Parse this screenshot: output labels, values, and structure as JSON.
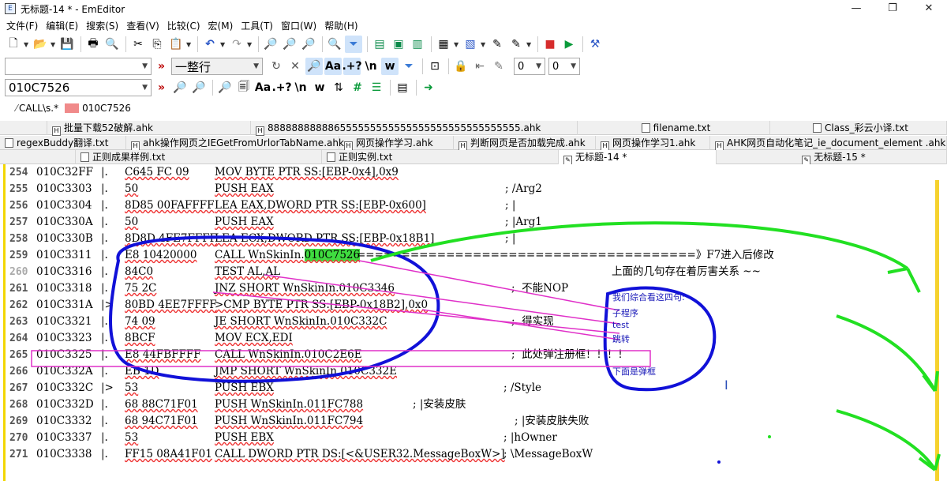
{
  "window": {
    "title": "无标题-14 * - EmEditor",
    "app_icon": "app-icon",
    "controls": [
      "—",
      "❐",
      "✕"
    ]
  },
  "menu": [
    "文件(F)",
    "编辑(E)",
    "搜索(S)",
    "查看(V)",
    "比较(C)",
    "宏(M)",
    "工具(T)",
    "窗口(W)",
    "帮助(H)"
  ],
  "toolbar2": {
    "combo1_value": "",
    "combo2_value": "一整行",
    "num1": "0",
    "num2": "0"
  },
  "toolbar3": {
    "search_value": "010C7526"
  },
  "searchbar": {
    "pattern": "CALL\\s.*",
    "highlight_text": "010C7526"
  },
  "tabs_row1": [
    "批量下载52破解.ahk",
    "888888888886555555555555555555555555555555.ahk",
    "filename.txt",
    "Class_彩云小译.txt"
  ],
  "tabs_row2": [
    "regexBuddy翻译.txt",
    "ahk操作网页之IEGetFromUrlorTabName.ahk",
    "网页操作学习.ahk",
    "判断网页是否加载完成.ahk",
    "网页操作学习1.ahk",
    "AHK网页自动化笔记_ie_document_element .ahk"
  ],
  "tabs_row3": [
    "正则成果样例.txt",
    "正则实例.txt",
    "无标题-14 *",
    "无标题-15 *"
  ],
  "lines": [
    {
      "n": "254",
      "addr": "010C32FF",
      "mark": "|.",
      "hex": "C645 FC 09",
      "asm": "MOV BYTE PTR SS:[EBP-0x4],0x9",
      "cmt": ""
    },
    {
      "n": "255",
      "addr": "010C3303",
      "mark": "|.",
      "hex": "50",
      "asm": "PUSH EAX",
      "cmt": "; /Arg2"
    },
    {
      "n": "256",
      "addr": "010C3304",
      "mark": "|.",
      "hex": "8D85 00FAFFFF",
      "asm": "LEA EAX,DWORD PTR SS:[EBP-0x600]",
      "cmt": "; |"
    },
    {
      "n": "257",
      "addr": "010C330A",
      "mark": "|.",
      "hex": "50",
      "asm": "PUSH EAX",
      "cmt": "; |Arg1"
    },
    {
      "n": "258",
      "addr": "010C330B",
      "mark": "|.",
      "hex": "8D8D 4FE7FFFF",
      "asm": "LEA ECX,DWORD PTR SS:[EBP-0x18B1]",
      "cmt": "; |"
    },
    {
      "n": "259",
      "addr": "010C3311",
      "mark": "|.",
      "hex": "E8 10420000",
      "asm": "CALL WnSkinIn.",
      "asm_hl": "010C7526",
      "cmt": "======================================》F7进入后修改"
    },
    {
      "n": "260",
      "addr": "010C3316",
      "mark": "|.",
      "hex": "84C0",
      "asm": "TEST AL,AL",
      "cmt": "上面的几句存在着厉害关系 ~~"
    },
    {
      "n": "261",
      "addr": "010C3318",
      "mark": "|.",
      "hex": "75 2C",
      "asm": "JNZ SHORT WnSkinIn.010C3346",
      "cmt": ";  不能NOP"
    },
    {
      "n": "262",
      "addr": "010C331A",
      "mark": "|>",
      "hex": "80BD 4EE7FFFF",
      "asm": ">CMP BYTE PTR SS:[EBP-0x18B2],0x0",
      "cmt": ""
    },
    {
      "n": "263",
      "addr": "010C3321",
      "mark": "|.",
      "hex": "74 09",
      "asm": "JE SHORT WnSkinIn.010C332C",
      "cmt": ";  得实现"
    },
    {
      "n": "264",
      "addr": "010C3323",
      "mark": "|.",
      "hex": "8BCF",
      "asm": "MOV ECX,EDI",
      "cmt": ""
    },
    {
      "n": "265",
      "addr": "010C3325",
      "mark": "|.",
      "hex": "E8 44FBFFFF",
      "asm": "CALL WnSkinIn.010C2E6E",
      "cmt": ";  此处弹注册框！！！！"
    },
    {
      "n": "266",
      "addr": "010C332A",
      "mark": "|.",
      "hex": "EB 1D",
      "asm": "JMP SHORT WnSkinIn.010C332E",
      "cmt": ""
    },
    {
      "n": "267",
      "addr": "010C332C",
      "mark": "|>",
      "hex": "53",
      "asm": "PUSH EBX",
      "cmt": "; /Style"
    },
    {
      "n": "268",
      "addr": "010C332D",
      "mark": "|.",
      "hex": "68 88C71F01",
      "asm": "PUSH WnSkinIn.011FC788",
      "cmt": "; |安装皮肤"
    },
    {
      "n": "269",
      "addr": "010C3332",
      "mark": "|.",
      "hex": "68 94C71F01",
      "asm": "PUSH WnSkinIn.011FC794",
      "cmt": "; |安装皮肤失败"
    },
    {
      "n": "270",
      "addr": "010C3337",
      "mark": "|.",
      "hex": "53",
      "asm": "PUSH EBX",
      "cmt": "; |hOwner"
    },
    {
      "n": "271",
      "addr": "010C3338",
      "mark": "|.",
      "hex": "FF15 08A41F01",
      "asm": "CALL DWORD PTR DS:[<&USER32.MessageBoxW>]",
      "cmt": "; \\MessageBoxW"
    }
  ],
  "annotations": {
    "note_title": "我们综合看这四句:",
    "note_items": [
      "子程序",
      "test",
      "跳转"
    ],
    "note_popup": "下面是弹框"
  }
}
